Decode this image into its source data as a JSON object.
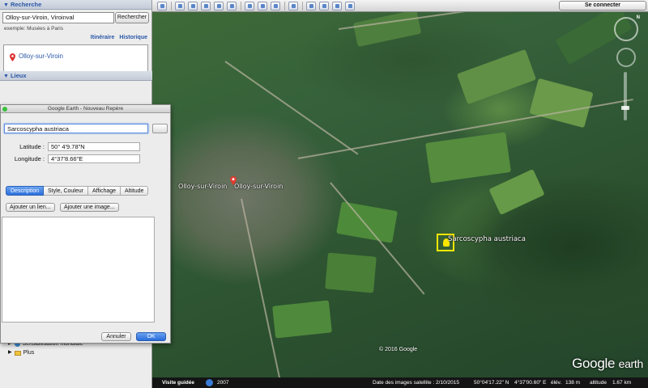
{
  "search": {
    "header": "Recherche",
    "query": "Olloy-sur-Viroin, Viroinval",
    "button": "Rechercher",
    "example": "exemple: Musées à Paris",
    "link_itineraire": "Itinéraire",
    "link_historique": "Historique",
    "result": "Olloy-sur-Viroin"
  },
  "places": {
    "header": "Lieux",
    "items": [
      {
        "label": "Sensibilisation mondiale",
        "icon": "globe-icon"
      },
      {
        "label": "Plus",
        "icon": "folder-icon"
      }
    ]
  },
  "dialog": {
    "title": "Google Earth - Nouveau Repère",
    "name_value": "Sarcoscypha austriaca",
    "latitude_label": "Latitude :",
    "latitude_value": "50° 4'9.78\"N",
    "longitude_label": "Longitude :",
    "longitude_value": "4°37'8.66\"E",
    "tabs": [
      "Description",
      "Style, Couleur",
      "Affichage",
      "Altitude"
    ],
    "active_tab": "Description",
    "add_link": "Ajouter un lien...",
    "add_image": "Ajouter une image...",
    "cancel": "Annuler",
    "ok": "OK"
  },
  "toolbar": {
    "connect": "Se connecter"
  },
  "map": {
    "label_town": "Olloy-sur-Viroin",
    "label_placemark": "Sarcoscypha austriaca",
    "copyright": "© 2016 Google",
    "logo_google": "Google",
    "logo_earth": "earth",
    "compass_n": "N"
  },
  "status": {
    "tour": "Visite guidée",
    "year": "2007",
    "imagery_date": "Date des images satellite : 2/10/2015",
    "lat": "50°04'17.22\" N",
    "lon": "4°37'00.60\" E",
    "elev_label": "élév.",
    "elev": "138 m",
    "alt_label": "altitude",
    "alt": "1.67 km"
  },
  "colors": {
    "accent": "#2b57a8",
    "placemark": "#ffe600"
  }
}
